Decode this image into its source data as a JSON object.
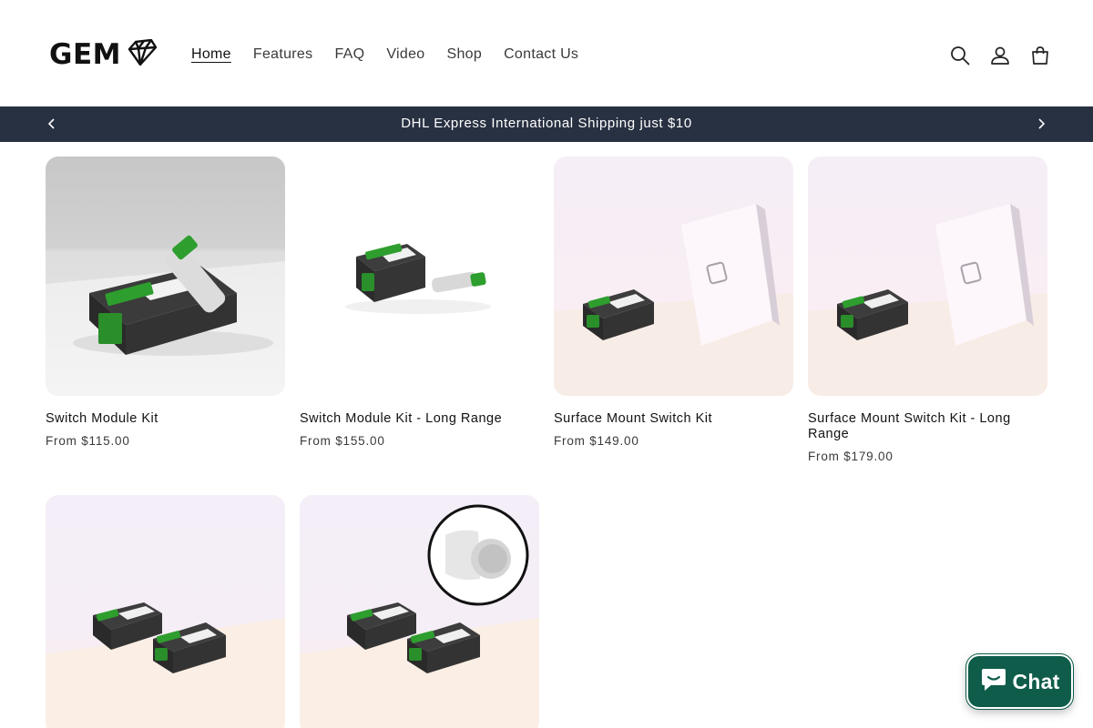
{
  "brand": {
    "name": "GEM"
  },
  "nav": {
    "items": [
      {
        "label": "Home",
        "active": true
      },
      {
        "label": "Features"
      },
      {
        "label": "FAQ"
      },
      {
        "label": "Video"
      },
      {
        "label": "Shop"
      },
      {
        "label": "Contact Us"
      }
    ]
  },
  "header_icons": [
    "search-icon",
    "account-icon",
    "cart-icon"
  ],
  "announcement": {
    "text": "DHL Express International Shipping just $10"
  },
  "products": [
    {
      "title": "Switch Module Kit",
      "price": "From $115.00"
    },
    {
      "title": "Switch Module Kit - Long Range",
      "price": "From $155.00"
    },
    {
      "title": "Surface Mount Switch Kit",
      "price": "From $149.00"
    },
    {
      "title": "Surface Mount Switch Kit - Long Range",
      "price": "From $179.00"
    },
    {
      "title": "",
      "price": ""
    },
    {
      "title": "",
      "price": ""
    }
  ],
  "chat": {
    "label": "Chat"
  },
  "colors": {
    "announcement_bg": "#283142",
    "chat_bg": "#0f5c4a",
    "module_green": "#2e9e2e"
  }
}
